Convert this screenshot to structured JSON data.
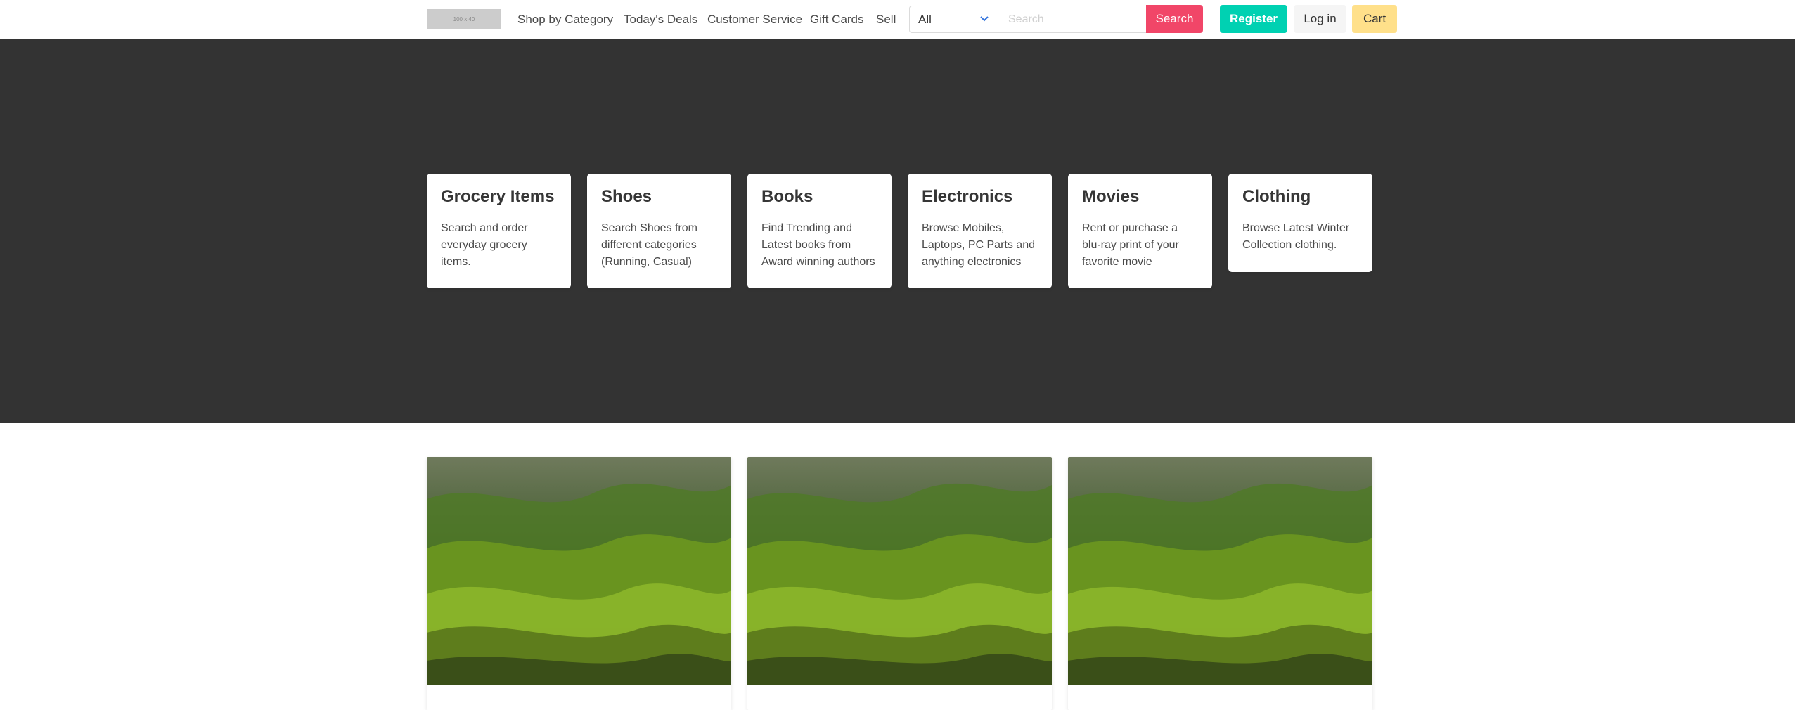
{
  "navbar": {
    "logo_text": "100 x 40",
    "links": [
      "Shop by Category",
      "Today's Deals",
      "Customer Service",
      "Gift Cards",
      "Sell"
    ],
    "select_value": "All",
    "search_placeholder": "Search",
    "search_button": "Search",
    "register_button": "Register",
    "login_button": "Log in",
    "cart_button": "Cart"
  },
  "categories": [
    {
      "title": "Grocery Items",
      "description": "Search and order everyday grocery items."
    },
    {
      "title": "Shoes",
      "description": "Search Shoes from different categories (Running, Casual)"
    },
    {
      "title": "Books",
      "description": "Find Trending and Latest books from Award winning authors"
    },
    {
      "title": "Electronics",
      "description": "Browse Mobiles, Laptops, PC Parts and anything electronics"
    },
    {
      "title": "Movies",
      "description": "Rent or purchase a blu-ray print of your favorite movie"
    },
    {
      "title": "Clothing",
      "description": "Browse Latest Winter Collection clothing."
    }
  ],
  "products": [
    {
      "image": "green-rolling-hills-landscape"
    },
    {
      "image": "green-rolling-hills-landscape"
    },
    {
      "image": "green-rolling-hills-landscape"
    }
  ],
  "colors": {
    "hero_background": "#333333",
    "search_button": "#f14668",
    "register_button": "#00d1b2",
    "login_button": "#f5f5f5",
    "cart_button": "#ffe08a",
    "chevron": "#3273dc"
  }
}
